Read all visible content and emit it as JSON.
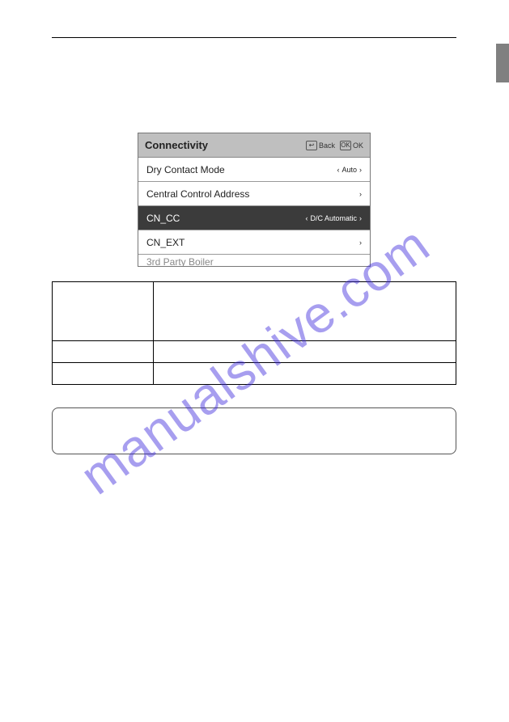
{
  "watermark": "manualshive.com",
  "menu": {
    "title": "Connectivity",
    "back_label": "Back",
    "ok_label": "OK",
    "rows": [
      {
        "label": "Dry Contact Mode",
        "value": "Auto",
        "has_left": true,
        "selected": false
      },
      {
        "label": "Central Control Address",
        "value": "",
        "has_left": false,
        "selected": false
      },
      {
        "label": "CN_CC",
        "value": "D/C Automatic",
        "has_left": true,
        "selected": true
      },
      {
        "label": "CN_EXT",
        "value": "",
        "has_left": false,
        "selected": false
      }
    ],
    "truncated_label": "3rd Party Boiler"
  }
}
